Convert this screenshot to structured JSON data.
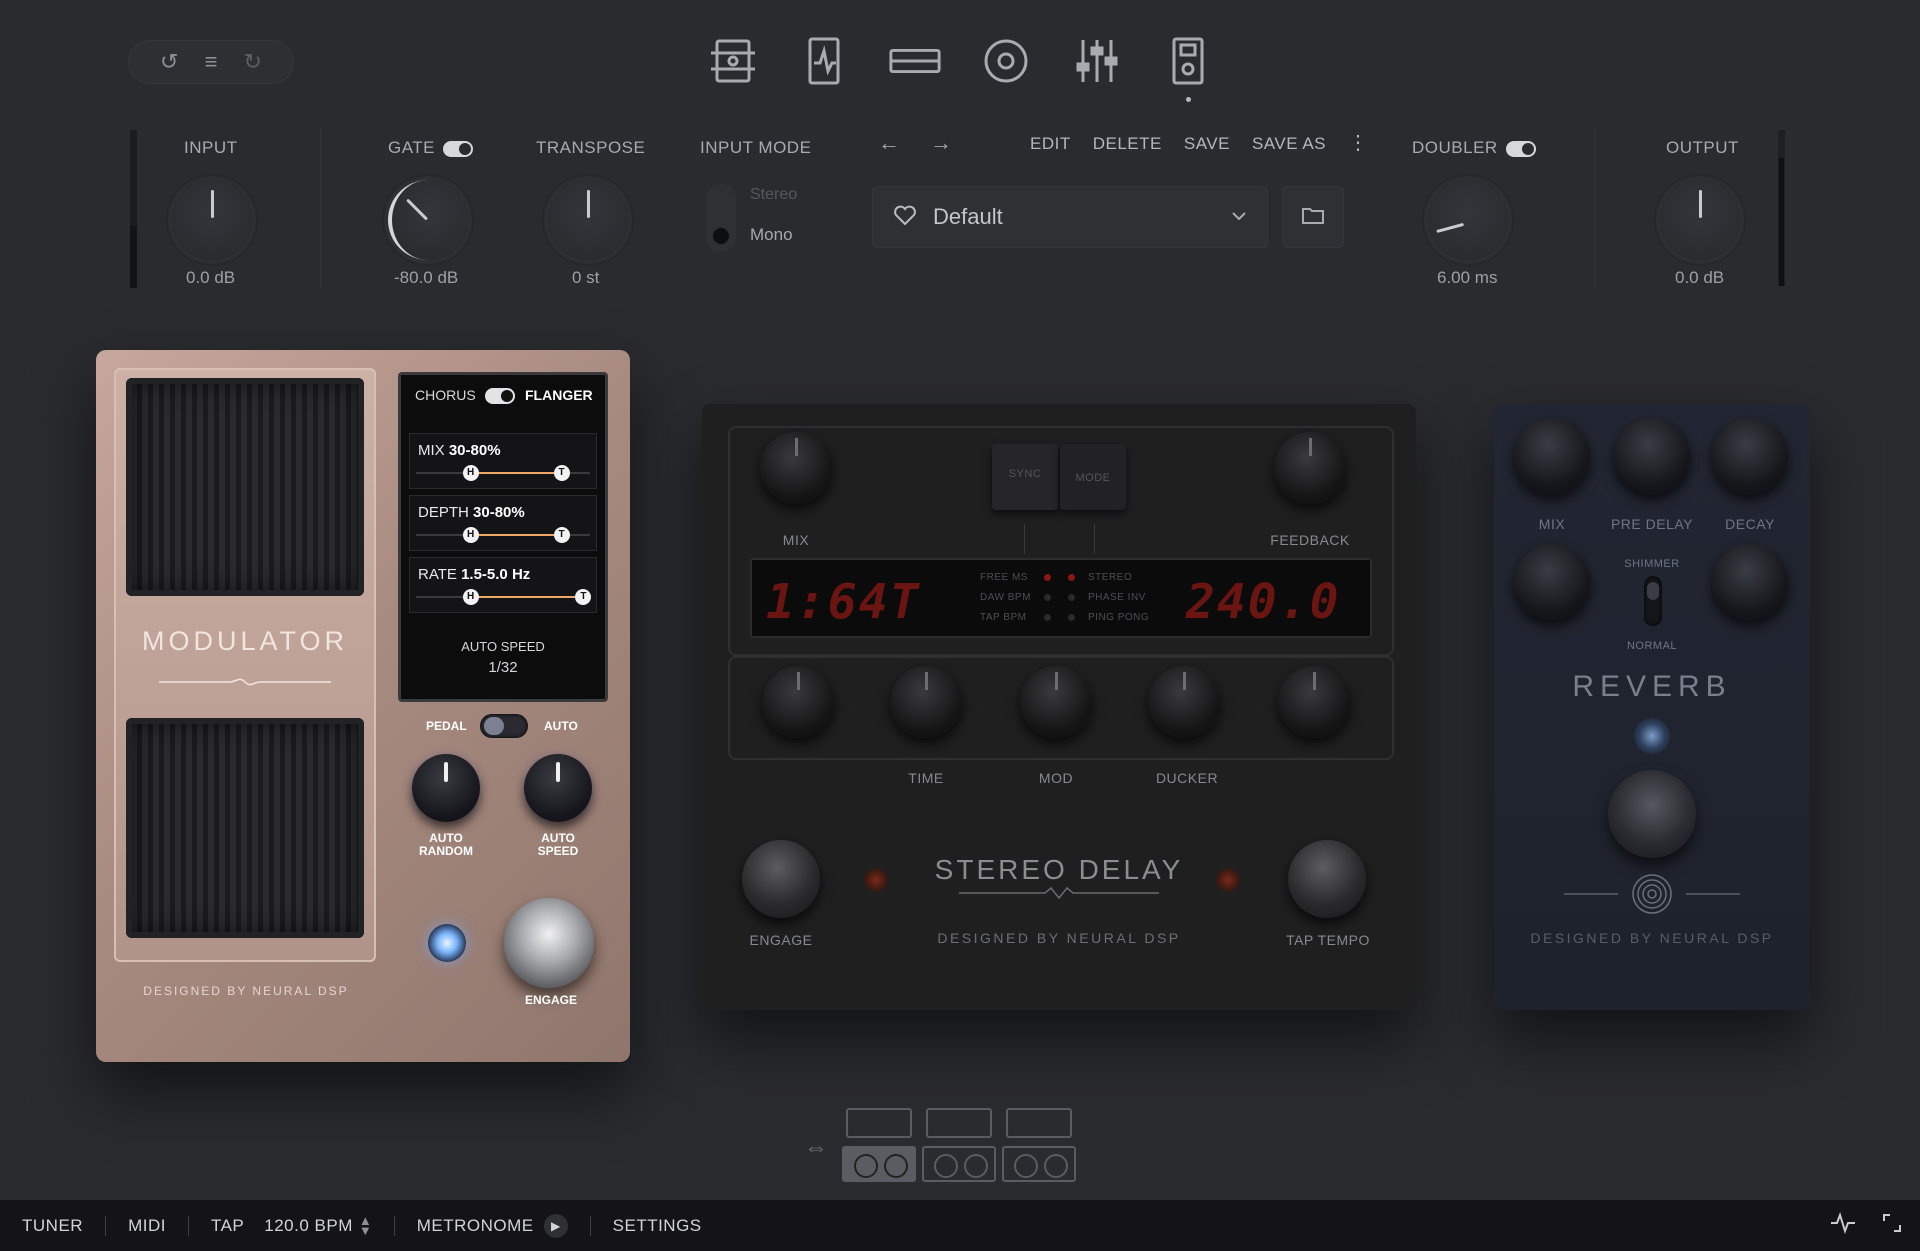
{
  "toolbar": {
    "undo_icon": "undo-icon",
    "menu_icon": "menu-icon",
    "redo_icon": "redo-icon",
    "views": [
      {
        "name": "amp-view-icon"
      },
      {
        "name": "stompbox-view-icon"
      },
      {
        "name": "cabinet-view-icon"
      },
      {
        "name": "speaker-view-icon"
      },
      {
        "name": "eq-view-icon"
      },
      {
        "name": "pedal-board-view-icon",
        "active": true
      }
    ]
  },
  "controls": {
    "input": {
      "label": "INPUT",
      "value": "0.0 dB"
    },
    "gate": {
      "label": "GATE",
      "value": "-80.0 dB",
      "on": true
    },
    "transpose": {
      "label": "TRANSPOSE",
      "value": "0 st"
    },
    "input_mode": {
      "label": "INPUT MODE",
      "options": [
        "Stereo",
        "Mono"
      ],
      "selected": "Mono"
    },
    "doubler": {
      "label": "DOUBLER",
      "value": "6.00 ms",
      "on": true
    },
    "output": {
      "label": "OUTPUT",
      "value": "0.0 dB"
    }
  },
  "preset": {
    "prev_arrow": "←",
    "next_arrow": "→",
    "actions": [
      "EDIT",
      "DELETE",
      "SAVE",
      "SAVE AS"
    ],
    "more": "⋮",
    "name": "Default",
    "favorite_icon": "heart-icon",
    "folder_icon": "folder-icon"
  },
  "modulator": {
    "title": "MODULATOR",
    "credit": "DESIGNED BY NEURAL DSP",
    "mode_left": "CHORUS",
    "mode_right": "FLANGER",
    "params": [
      {
        "name": "MIX",
        "range": "30-80%",
        "from": 0.3,
        "to": 0.8
      },
      {
        "name": "DEPTH",
        "range": "30-80%",
        "from": 0.3,
        "to": 0.8
      },
      {
        "name": "RATE",
        "range": "1.5-5.0 Hz",
        "from": 0.3,
        "to": 0.92
      }
    ],
    "handle_low": "H",
    "handle_high": "T",
    "auto_speed_label": "AUTO SPEED",
    "auto_speed_value": "1/32",
    "switch_left": "PEDAL",
    "switch_right": "AUTO",
    "knob1": "AUTO\nRANDOM",
    "knob2": "AUTO\nSPEED",
    "engage": "ENGAGE"
  },
  "delay": {
    "title": "STEREO DELAY",
    "credit": "DESIGNED BY NEURAL DSP",
    "mix": "MIX",
    "feedback": "FEEDBACK",
    "sync": "SYNC",
    "mode": "MODE",
    "display_left": "1:64T",
    "display_right": "240.0",
    "display_left_prefix": "",
    "display_right_prefix": "",
    "mode_left": [
      "FREE MS",
      "DAW BPM",
      "TAP BPM"
    ],
    "mode_right": [
      "STEREO",
      "PHASE INV",
      "PING PONG"
    ],
    "row_labels": [
      "TIME",
      "MOD",
      "DUCKER"
    ],
    "engage": "ENGAGE",
    "tap_tempo": "TAP TEMPO"
  },
  "reverb": {
    "title": "REVERB",
    "credit": "DESIGNED BY NEURAL DSP",
    "mix": "MIX",
    "pre_delay": "PRE DELAY",
    "decay": "DECAY",
    "shimmer": "SHIMMER",
    "normal": "NORMAL"
  },
  "chain": {
    "link_icon": "link-icon"
  },
  "bottom": {
    "tuner": "TUNER",
    "midi": "MIDI",
    "tap": "TAP",
    "bpm": "120.0 BPM",
    "metronome": "METRONOME",
    "settings": "SETTINGS",
    "activity_icon": "activity-icon",
    "resize_icon": "resize-icon"
  },
  "colors": {
    "background": "#2a2b2f",
    "modulator_body": "#b09084",
    "flanger_accent": "#f0a86a",
    "delay_body": "#1f1f20",
    "reverb_body": "#20242e",
    "led_blue": "#8fc3ff",
    "led_red": "#c44a2c"
  }
}
